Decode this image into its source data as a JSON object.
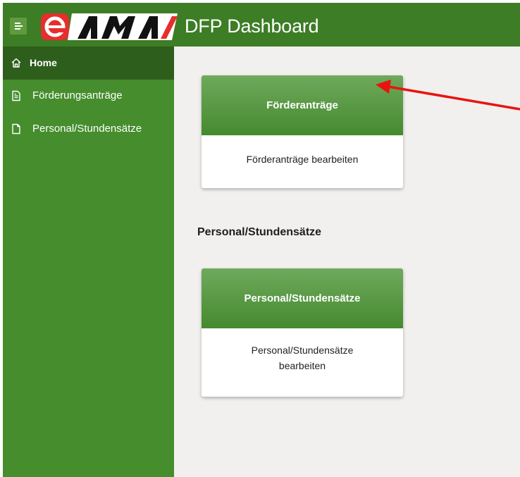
{
  "header": {
    "menu_icon": "hamburger-menu-icon",
    "logo_text": "eAMA",
    "title": "DFP Dashboard",
    "colors": {
      "bar": "#3c7d25",
      "logo_red": "#e62e2d"
    }
  },
  "sidebar": {
    "items": [
      {
        "label": "Home",
        "icon": "home-icon",
        "active": true
      },
      {
        "label": "Förderungsanträge",
        "icon": "document-icon",
        "active": false
      },
      {
        "label": "Personal/Stundensätze",
        "icon": "file-icon",
        "active": false
      }
    ],
    "colors": {
      "background": "#458d2d",
      "active": "#2e5e1c"
    }
  },
  "main": {
    "cards": [
      {
        "title": "Förderanträge",
        "description": "Förderanträge bearbeiten"
      },
      {
        "title": "Personal/Stundensätze",
        "description": "Personal/Stundensätze bearbeiten"
      }
    ],
    "section_heading": "Personal/Stundensätze"
  },
  "annotation": {
    "type": "arrow",
    "color": "#e8140f"
  }
}
